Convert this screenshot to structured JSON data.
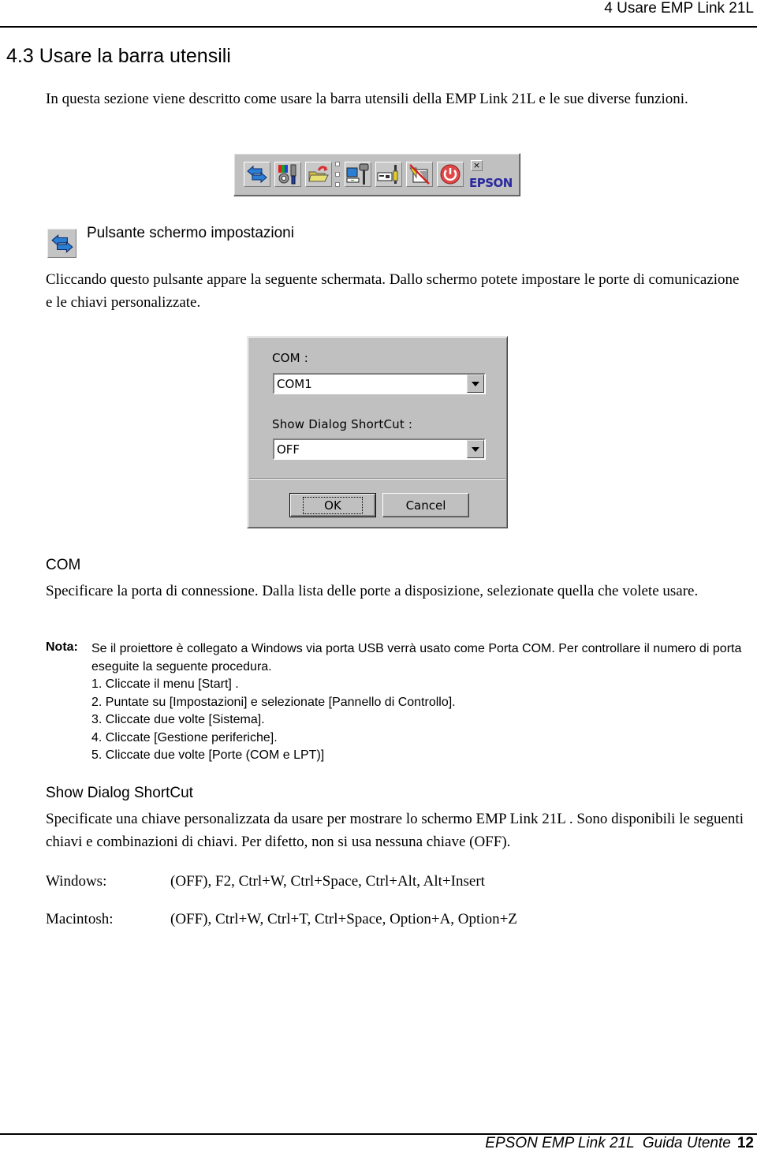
{
  "header": {
    "running_title": "4 Usare EMP Link 21L"
  },
  "section": {
    "title": "4.3  Usare la barra utensili",
    "intro": "In questa sezione viene descritto come usare la barra utensili della EMP Link 21L e le sue diverse funzioni."
  },
  "toolbar": {
    "buttons": [
      {
        "icon": "settings-arrows-icon"
      },
      {
        "icon": "color-adjust-icon"
      },
      {
        "icon": "open-folder-icon"
      },
      {
        "icon": "computer-connect-icon"
      },
      {
        "icon": "projector-cable-icon"
      },
      {
        "icon": "mute-image-icon"
      },
      {
        "icon": "power-icon"
      }
    ],
    "close_glyph": "×",
    "brand": "EPSON",
    "colors": {
      "face": "#c0c0c0",
      "brand": "#2a2a9e",
      "power": "#e04848",
      "arrows": "#2a7fd4"
    }
  },
  "settings_button": {
    "heading": "Pulsante schermo impostazioni",
    "description": "Cliccando questo pulsante appare la seguente schermata. Dallo schermo potete impostare le porte di comunicazione e le chiavi personalizzate."
  },
  "dialog": {
    "com_label": "COM :",
    "com_value": "COM1",
    "shortcut_label": "Show Dialog ShortCut :",
    "shortcut_value": "OFF",
    "ok_label": "OK",
    "cancel_label": "Cancel"
  },
  "com_section": {
    "heading": "COM",
    "description": "Specificare la porta di connessione. Dalla lista delle porte a disposizione, selezionate quella che volete usare."
  },
  "note": {
    "label": "Nota:",
    "text": "Se il proiettore è collegato a Windows via porta USB verrà usato come Porta COM. Per controllare il numero di porta eseguite la seguente procedura.",
    "steps": [
      "1. Cliccate il menu [Start] .",
      "2. Puntate su [Impostazioni] e selezionate [Pannello di Controllo].",
      "3. Cliccate due volte [Sistema].",
      "4. Cliccate [Gestione periferiche].",
      "5. Cliccate due volte [Porte (COM e LPT)]"
    ]
  },
  "shortcut_section": {
    "heading": "Show Dialog ShortCut",
    "description": "Specificate una chiave personalizzata da usare per mostrare lo schermo EMP Link 21L . Sono disponibili le seguenti chiavi e combinazioni di chiavi. Per difetto, non si usa nessuna chiave (OFF).",
    "keys": [
      {
        "platform": "Windows:",
        "values": "(OFF), F2, Ctrl+W, Ctrl+Space, Ctrl+Alt, Alt+Insert"
      },
      {
        "platform": "Macintosh:",
        "values": "(OFF), Ctrl+W, Ctrl+T, Ctrl+Space, Option+A, Option+Z"
      }
    ]
  },
  "footer": {
    "title": "EPSON EMP Link 21L  Guida Utente",
    "page": "12"
  }
}
